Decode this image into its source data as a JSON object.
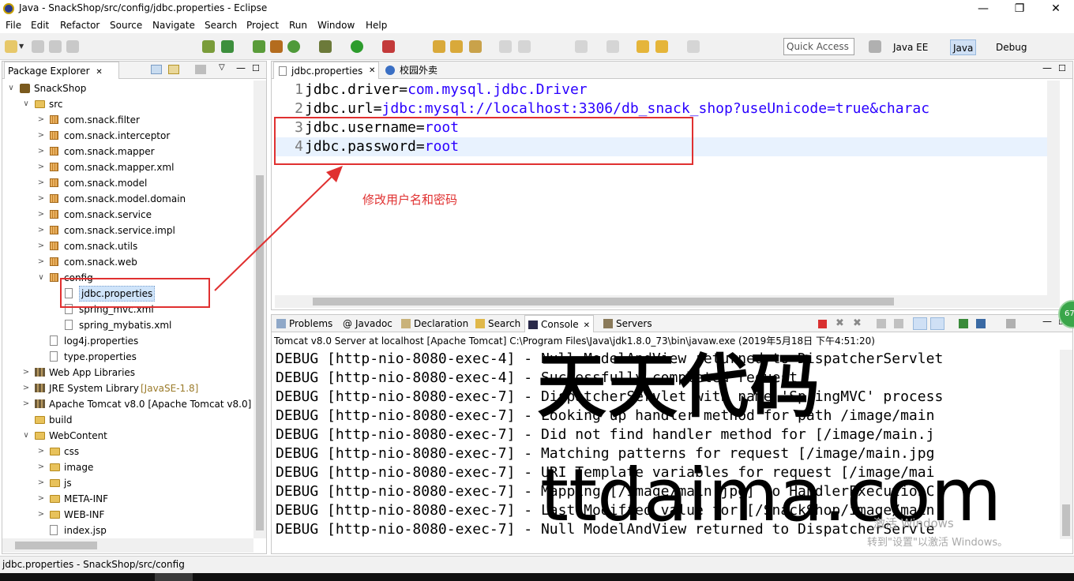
{
  "window": {
    "title": "Java - SnackShop/src/config/jdbc.properties - Eclipse",
    "minimize": "—",
    "maximize": "❐",
    "close": "✕"
  },
  "menu": [
    "File",
    "Edit",
    "Refactor",
    "Source",
    "Navigate",
    "Search",
    "Project",
    "Run",
    "Window",
    "Help"
  ],
  "toolbar": {
    "quick_access": "Quick Access",
    "perspectives": {
      "javaee": "Java EE",
      "java": "Java",
      "debug": "Debug"
    }
  },
  "explorer": {
    "tab_label": "Package Explorer",
    "tree": [
      {
        "label": "SnackShop",
        "twisty": "∨",
        "icon": "project",
        "depth": 0
      },
      {
        "label": "src",
        "twisty": "∨",
        "icon": "folder",
        "depth": 1
      },
      {
        "label": "com.snack.filter",
        "twisty": ">",
        "icon": "package",
        "depth": 2
      },
      {
        "label": "com.snack.interceptor",
        "twisty": ">",
        "icon": "package",
        "depth": 2
      },
      {
        "label": "com.snack.mapper",
        "twisty": ">",
        "icon": "package",
        "depth": 2
      },
      {
        "label": "com.snack.mapper.xml",
        "twisty": ">",
        "icon": "package",
        "depth": 2
      },
      {
        "label": "com.snack.model",
        "twisty": ">",
        "icon": "package",
        "depth": 2
      },
      {
        "label": "com.snack.model.domain",
        "twisty": ">",
        "icon": "package",
        "depth": 2
      },
      {
        "label": "com.snack.service",
        "twisty": ">",
        "icon": "package",
        "depth": 2
      },
      {
        "label": "com.snack.service.impl",
        "twisty": ">",
        "icon": "package",
        "depth": 2
      },
      {
        "label": "com.snack.utils",
        "twisty": ">",
        "icon": "package",
        "depth": 2
      },
      {
        "label": "com.snack.web",
        "twisty": ">",
        "icon": "package",
        "depth": 2
      },
      {
        "label": "config",
        "twisty": "∨",
        "icon": "package",
        "depth": 2
      },
      {
        "label": "jdbc.properties",
        "twisty": "",
        "icon": "file",
        "depth": 3,
        "selected": true
      },
      {
        "label": "spring_mvc.xml",
        "twisty": "",
        "icon": "file",
        "depth": 3
      },
      {
        "label": "spring_mybatis.xml",
        "twisty": "",
        "icon": "file",
        "depth": 3
      },
      {
        "label": "log4j.properties",
        "twisty": "",
        "icon": "file",
        "depth": 2
      },
      {
        "label": "type.properties",
        "twisty": "",
        "icon": "file",
        "depth": 2
      },
      {
        "label": "Web App Libraries",
        "twisty": ">",
        "icon": "library",
        "depth": 1
      },
      {
        "label": "JRE System Library",
        "deco": "[JavaSE-1.8]",
        "twisty": ">",
        "icon": "library",
        "depth": 1
      },
      {
        "label": "Apache Tomcat v8.0 [Apache Tomcat v8.0]",
        "twisty": ">",
        "icon": "library",
        "depth": 1
      },
      {
        "label": "build",
        "twisty": "",
        "icon": "folder",
        "depth": 1
      },
      {
        "label": "WebContent",
        "twisty": "∨",
        "icon": "folder",
        "depth": 1
      },
      {
        "label": "css",
        "twisty": ">",
        "icon": "folder",
        "depth": 2
      },
      {
        "label": "image",
        "twisty": ">",
        "icon": "folder",
        "depth": 2
      },
      {
        "label": "js",
        "twisty": ">",
        "icon": "folder",
        "depth": 2
      },
      {
        "label": "META-INF",
        "twisty": ">",
        "icon": "folder",
        "depth": 2
      },
      {
        "label": "WEB-INF",
        "twisty": ">",
        "icon": "folder",
        "depth": 2
      },
      {
        "label": "index.jsp",
        "twisty": "",
        "icon": "file",
        "depth": 2
      }
    ]
  },
  "editor": {
    "tabs": [
      {
        "label": "jdbc.properties"
      },
      {
        "label": "校园外卖"
      }
    ],
    "lines": [
      {
        "num": "1",
        "key": "jdbc.driver",
        "eq": "=",
        "val": "com.mysql.jdbc.Driver"
      },
      {
        "num": "2",
        "key": "jdbc.url",
        "eq": "=",
        "val": "jdbc:mysql://localhost:3306/db_snack_shop?useUnicode=true&charac"
      },
      {
        "num": "3",
        "key": "jdbc.username",
        "eq": "=",
        "val": "root"
      },
      {
        "num": "4",
        "key": "jdbc.password",
        "eq": "=",
        "val": "root"
      }
    ],
    "annotation": "修改用户名和密码"
  },
  "console": {
    "tabs": [
      "Problems",
      "Javadoc",
      "Declaration",
      "Search",
      "Console",
      "Servers"
    ],
    "header": "Tomcat v8.0 Server at localhost [Apache Tomcat] C:\\Program Files\\Java\\jdk1.8.0_73\\bin\\javaw.exe (2019年5月18日 下午4:51:20)",
    "lines": [
      "DEBUG [http-nio-8080-exec-4] - Null ModelAndView returned to DispatcherServlet",
      "DEBUG [http-nio-8080-exec-4] - Successfully completed request",
      "DEBUG [http-nio-8080-exec-7] - DispatcherServlet with name 'SpringMVC' process",
      "DEBUG [http-nio-8080-exec-7] - Looking up handler method for path /image/main",
      "DEBUG [http-nio-8080-exec-7] - Did not find handler method for [/image/main.j",
      "DEBUG [http-nio-8080-exec-7] - Matching patterns for request [/image/main.jpg",
      "DEBUG [http-nio-8080-exec-7] - URI Template variables for request [/image/mai",
      "DEBUG [http-nio-8080-exec-7] - Mapping [/image/main.jpg] to HandlerExecutionC",
      "DEBUG [http-nio-8080-exec-7] - Last-Modified value for [/SnackShop/image/main",
      "DEBUG [http-nio-8080-exec-7] - Null ModelAndView returned to DispatcherServle"
    ]
  },
  "watermark": {
    "line1": "天天代码",
    "line2": "ttdaima.com",
    "activation1": "激活 Windows",
    "activation2": "转到\"设置\"以激活 Windows。"
  },
  "status": {
    "path": "jdbc.properties - SnackShop/src/config"
  },
  "badge": "67",
  "colors": {
    "highlight_box": "#e03030",
    "annotation": "#e03030",
    "value": "#2a00ff",
    "selection": "#cfe4fa"
  }
}
